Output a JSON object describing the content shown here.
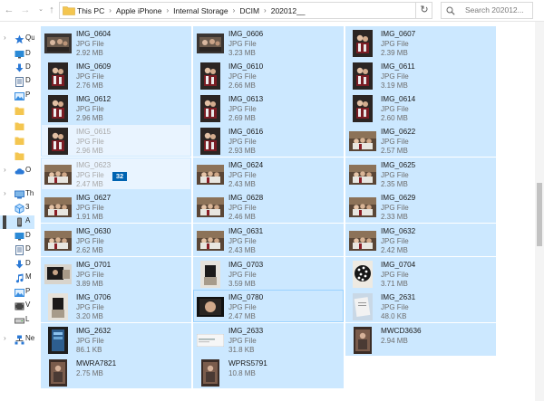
{
  "breadcrumbs": [
    {
      "label": "This PC"
    },
    {
      "label": "Apple iPhone"
    },
    {
      "label": "Internal Storage"
    },
    {
      "label": "DCIM"
    },
    {
      "label": "202012__"
    }
  ],
  "search": {
    "placeholder": "Search 202012..."
  },
  "nav_pane": [
    {
      "name": "quick-access",
      "label": "Qu",
      "icon": "star-icon",
      "color": "#2b79d6",
      "chev": "›"
    },
    {
      "name": "desktop",
      "label": "D",
      "icon": "desktop-icon",
      "color": "#2b8ad6",
      "chev": ""
    },
    {
      "name": "downloads",
      "label": "D",
      "icon": "download-icon",
      "color": "#2b79d6",
      "chev": ""
    },
    {
      "name": "documents",
      "label": "D",
      "icon": "document-icon",
      "color": "#5b7aa0",
      "chev": ""
    },
    {
      "name": "pictures",
      "label": "P",
      "icon": "pictures-icon",
      "color": "#3a8ee0",
      "chev": ""
    },
    {
      "name": "folder-1",
      "label": "",
      "icon": "folder-icon",
      "color": "#f4c650",
      "chev": ""
    },
    {
      "name": "folder-2",
      "label": "",
      "icon": "folder-icon",
      "color": "#f4c650",
      "chev": ""
    },
    {
      "name": "folder-3",
      "label": "",
      "icon": "folder-icon",
      "color": "#f4c650",
      "chev": ""
    },
    {
      "name": "folder-4",
      "label": "",
      "icon": "folder-icon",
      "color": "#f4c650",
      "chev": ""
    },
    {
      "name": "onedrive",
      "label": "O",
      "icon": "cloud-icon",
      "color": "#2b79d6",
      "chev": "›"
    },
    {
      "name": "this-pc",
      "label": "Th",
      "icon": "computer-icon",
      "color": "#3a7bc8",
      "chev": "›"
    },
    {
      "name": "3d-objects",
      "label": "3",
      "icon": "cube-icon",
      "color": "#3a8ee0",
      "chev": ""
    },
    {
      "name": "apple-iphone",
      "label": "A",
      "icon": "phone-icon",
      "color": "#444444",
      "chev": ""
    },
    {
      "name": "desktop-2",
      "label": "D",
      "icon": "desktop-icon",
      "color": "#2b8ad6",
      "chev": ""
    },
    {
      "name": "documents-2",
      "label": "D",
      "icon": "document-icon",
      "color": "#5b7aa0",
      "chev": ""
    },
    {
      "name": "downloads-2",
      "label": "D",
      "icon": "download-icon",
      "color": "#2b79d6",
      "chev": ""
    },
    {
      "name": "music",
      "label": "M",
      "icon": "music-icon",
      "color": "#2b79d6",
      "chev": ""
    },
    {
      "name": "pictures-2",
      "label": "P",
      "icon": "pictures-icon",
      "color": "#3a8ee0",
      "chev": ""
    },
    {
      "name": "videos",
      "label": "V",
      "icon": "video-icon",
      "color": "#444444",
      "chev": ""
    },
    {
      "name": "local-disk",
      "label": "L",
      "icon": "drive-icon",
      "color": "#666666",
      "chev": ""
    },
    {
      "name": "network",
      "label": "Ne",
      "icon": "network-icon",
      "color": "#2b79d6",
      "chev": "›"
    }
  ],
  "drag_count": "32",
  "files": [
    {
      "name": "IMG_0604",
      "type": "JPG File",
      "size": "2.92 MB",
      "thumb": "landscape-dark"
    },
    {
      "name": "IMG_0606",
      "type": "JPG File",
      "size": "3.23 MB",
      "thumb": "landscape-dark"
    },
    {
      "name": "IMG_0607",
      "type": "JPG File",
      "size": "2.39 MB",
      "thumb": "portrait-dark"
    },
    {
      "name": "IMG_0609",
      "type": "JPG File",
      "size": "2.76 MB",
      "thumb": "portrait-dark"
    },
    {
      "name": "IMG_0610",
      "type": "JPG File",
      "size": "2.66 MB",
      "thumb": "portrait-dark"
    },
    {
      "name": "IMG_0611",
      "type": "JPG File",
      "size": "3.19 MB",
      "thumb": "portrait-dark"
    },
    {
      "name": "IMG_0612",
      "type": "JPG File",
      "size": "2.96 MB",
      "thumb": "portrait-dark"
    },
    {
      "name": "IMG_0613",
      "type": "JPG File",
      "size": "2.69 MB",
      "thumb": "portrait-dark"
    },
    {
      "name": "IMG_0614",
      "type": "JPG File",
      "size": "2.60 MB",
      "thumb": "portrait-dark"
    },
    {
      "name": "IMG_0615",
      "type": "JPG File",
      "size": "2.96 MB",
      "thumb": "portrait-dark"
    },
    {
      "name": "IMG_0616",
      "type": "JPG File",
      "size": "2.93 MB",
      "thumb": "portrait-dark"
    },
    {
      "name": "IMG_0622",
      "type": "JPG File",
      "size": "2.57 MB",
      "thumb": "landscape-room"
    },
    {
      "name": "IMG_0623",
      "type": "JPG File",
      "size": "2.47 MB",
      "thumb": "landscape-room"
    },
    {
      "name": "IMG_0624",
      "type": "JPG File",
      "size": "2.43 MB",
      "thumb": "landscape-room"
    },
    {
      "name": "IMG_0625",
      "type": "JPG File",
      "size": "2.35 MB",
      "thumb": "landscape-room"
    },
    {
      "name": "IMG_0627",
      "type": "JPG File",
      "size": "1.91 MB",
      "thumb": "landscape-room"
    },
    {
      "name": "IMG_0628",
      "type": "JPG File",
      "size": "2.46 MB",
      "thumb": "landscape-room"
    },
    {
      "name": "IMG_0629",
      "type": "JPG File",
      "size": "2.33 MB",
      "thumb": "landscape-room"
    },
    {
      "name": "IMG_0630",
      "type": "JPG File",
      "size": "2.62 MB",
      "thumb": "landscape-room"
    },
    {
      "name": "IMG_0631",
      "type": "JPG File",
      "size": "2.43 MB",
      "thumb": "landscape-room"
    },
    {
      "name": "IMG_0632",
      "type": "JPG File",
      "size": "2.42 MB",
      "thumb": "landscape-room"
    },
    {
      "name": "IMG_0701",
      "type": "JPG File",
      "size": "3.89 MB",
      "thumb": "landscape-bright"
    },
    {
      "name": "IMG_0703",
      "type": "JPG File",
      "size": "3.59 MB",
      "thumb": "portrait-bright"
    },
    {
      "name": "IMG_0704",
      "type": "JPG File",
      "size": "3.71 MB",
      "thumb": "portrait-dots"
    },
    {
      "name": "IMG_0706",
      "type": "JPG File",
      "size": "3.20 MB",
      "thumb": "portrait-bright"
    },
    {
      "name": "IMG_0780",
      "type": "JPG File",
      "size": "2.47 MB",
      "thumb": "landscape-face"
    },
    {
      "name": "IMG_2631",
      "type": "JPG File",
      "size": "48.0 KB",
      "thumb": "portrait-paper"
    },
    {
      "name": "IMG_2632",
      "type": "JPG File",
      "size": "86.1 KB",
      "thumb": "portrait-phone"
    },
    {
      "name": "IMG_2633",
      "type": "JPG File",
      "size": "31.8 KB",
      "thumb": "landscape-screen"
    },
    {
      "name": "MWCD3636",
      "type": "",
      "size": "2.94 MB",
      "thumb": "portrait-video"
    },
    {
      "name": "MWRA7821",
      "type": "",
      "size": "2.75 MB",
      "thumb": "portrait-video"
    },
    {
      "name": "WPRS5791",
      "type": "",
      "size": "10.8 MB",
      "thumb": "portrait-video"
    }
  ],
  "colors": {
    "tile_selected": "#cce8ff",
    "drag_badge": "#0063b1",
    "folder": "#f4c650"
  }
}
